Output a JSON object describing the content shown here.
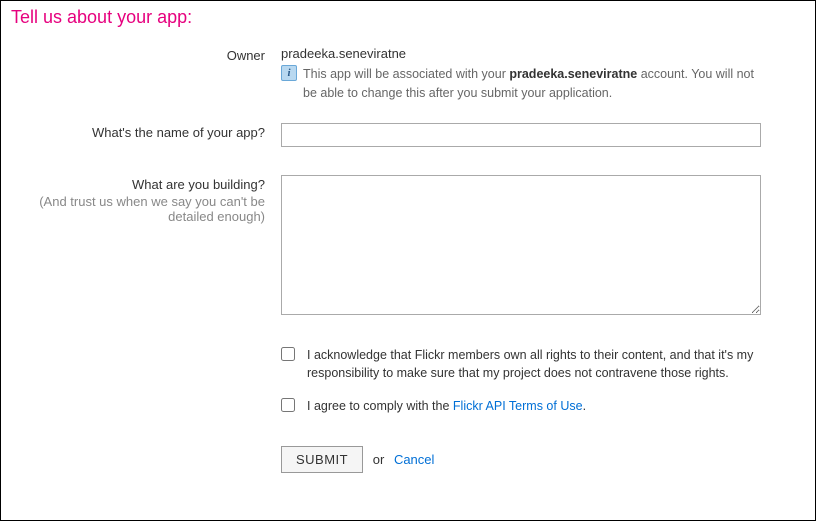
{
  "heading": "Tell us about your app:",
  "owner": {
    "label": "Owner",
    "username": "pradeeka.seneviratne",
    "note_prefix": "This app will be associated with your ",
    "note_bold": "pradeeka.seneviratne",
    "note_suffix": " account. You will not be able to change this after you submit your application."
  },
  "app_name": {
    "label": "What's the name of your app?",
    "value": ""
  },
  "building": {
    "label": "What are you building?",
    "hint": "(And trust us when we say you can't be detailed enough)",
    "value": ""
  },
  "ack": {
    "label": "I acknowledge that Flickr members own all rights to their content, and that it's my responsibility to make sure that my project does not contravene those rights."
  },
  "agree": {
    "prefix": "I agree to comply with the ",
    "link": "Flickr API Terms of Use",
    "suffix": "."
  },
  "actions": {
    "submit": "SUBMIT",
    "or": "or",
    "cancel": "Cancel"
  }
}
